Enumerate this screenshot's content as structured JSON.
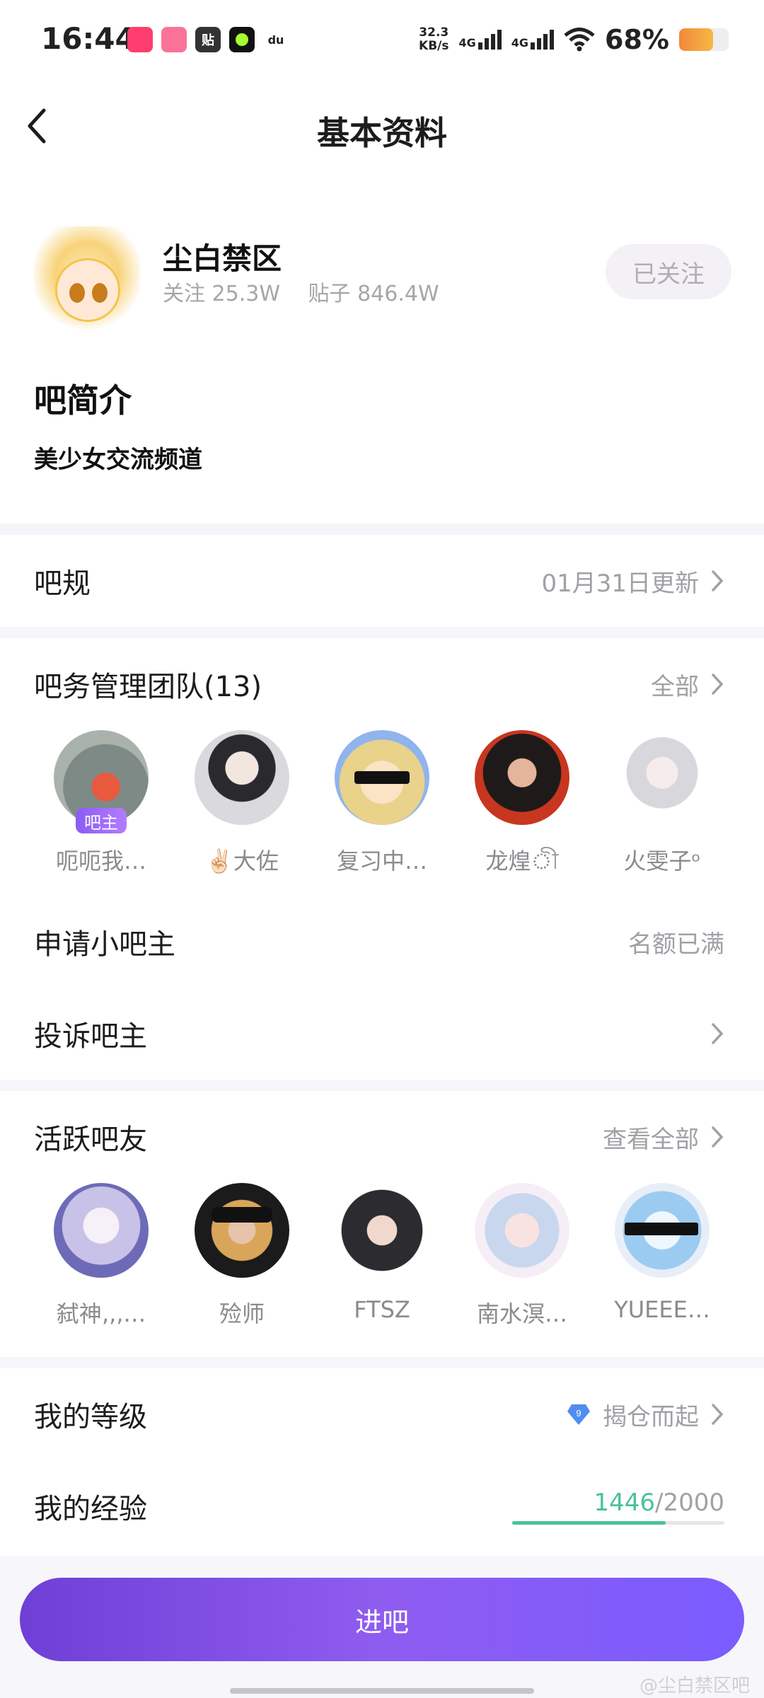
{
  "status_bar": {
    "time": "16:44",
    "net_speed_value": "32.3",
    "net_speed_unit": "KB/s",
    "signal1": "4G",
    "signal2": "4G",
    "battery": "68%",
    "battery_level": 0.68,
    "app_icons": [
      "app-icon-1",
      "bilibili-icon",
      "tieba-icon",
      "green-dot-icon",
      "baidu-map-icon"
    ],
    "app_icon_labels": [
      "",
      "",
      "贴",
      "",
      "du"
    ]
  },
  "header": {
    "title": "基本资料"
  },
  "forum": {
    "name": "尘白禁区",
    "followers_label": "关注 25.3W",
    "posts_label": "贴子 846.4W",
    "follow_button": "已关注",
    "intro_title": "吧简介",
    "intro_text": "美少女交流频道"
  },
  "rules": {
    "label": "吧规",
    "value": "01月31日更新"
  },
  "team": {
    "label": "吧务管理团队(13)",
    "more": "全部",
    "members": [
      {
        "name": "呃呃我…",
        "badge": "吧主"
      },
      {
        "name": "✌🏻大佐",
        "badge": ""
      },
      {
        "name": "复习中…",
        "badge": ""
      },
      {
        "name": "龙煌ী",
        "badge": ""
      },
      {
        "name": "火雯子ᵒ",
        "badge": ""
      }
    ]
  },
  "apply": {
    "label": "申请小吧主",
    "value": "名额已满"
  },
  "complain": {
    "label": "投诉吧主"
  },
  "active": {
    "label": "活跃吧友",
    "more": "查看全部",
    "members": [
      {
        "name": "弑神‚‚‚…"
      },
      {
        "name": "殓师"
      },
      {
        "name": "FTSZ"
      },
      {
        "name": "南水溟…"
      },
      {
        "name": "YUEEE…"
      }
    ]
  },
  "level": {
    "label": "我的等级",
    "level_number": "9",
    "title": "揭仓而起"
  },
  "exp": {
    "label": "我的经验",
    "current": "1446",
    "max": "/2000",
    "progress": 0.723
  },
  "bottom": {
    "enter_button": "进吧",
    "watermark": "@尘白禁区吧"
  },
  "colors": {
    "accent": "#7a4fe6",
    "exp_green": "#48c29a",
    "muted": "#a0a0a6"
  }
}
